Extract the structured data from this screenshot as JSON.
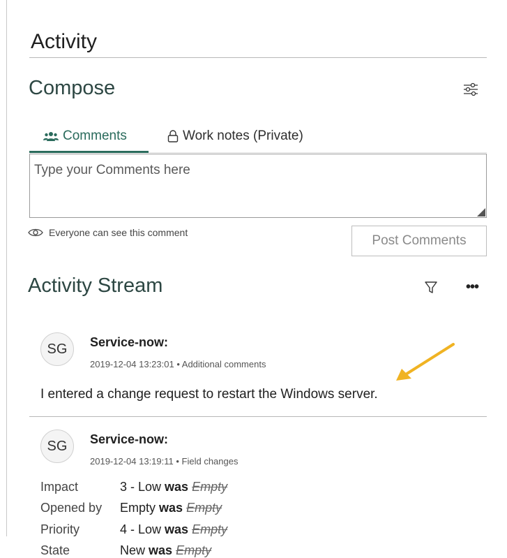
{
  "activity": {
    "title": "Activity"
  },
  "compose": {
    "title": "Compose",
    "settings_icon": "tune-sliders-icon",
    "tabs": [
      {
        "label": "Comments",
        "icon": "people-icon",
        "active": true
      },
      {
        "label": "Work notes (Private)",
        "icon": "lock-icon",
        "active": false
      }
    ],
    "input": {
      "placeholder": "Type your Comments here",
      "value": ""
    },
    "visibility_note": "Everyone can see this comment",
    "post_label": "Post Comments"
  },
  "stream": {
    "title": "Activity Stream",
    "entries": [
      {
        "initials": "SG",
        "author": "Service-now:",
        "meta": "2019-12-04 13:23:01 • Additional comments",
        "text": "I entered a change request to restart the Windows server."
      },
      {
        "initials": "SG",
        "author": "Service-now:",
        "meta": "2019-12-04 13:19:11 • Field changes",
        "fields": [
          {
            "name": "Impact",
            "new": "3 - Low",
            "was": "was",
            "old": "Empty"
          },
          {
            "name": "Opened by",
            "new": "Empty",
            "was": "was",
            "old": "Empty"
          },
          {
            "name": "Priority",
            "new": "4 - Low",
            "was": "was",
            "old": "Empty"
          },
          {
            "name": "State",
            "new": "New",
            "was": "was",
            "old": "Empty"
          }
        ]
      }
    ]
  },
  "colors": {
    "accent": "#2a6b5c",
    "heading": "#2d4743",
    "annotation_arrow": "#f0b323"
  }
}
